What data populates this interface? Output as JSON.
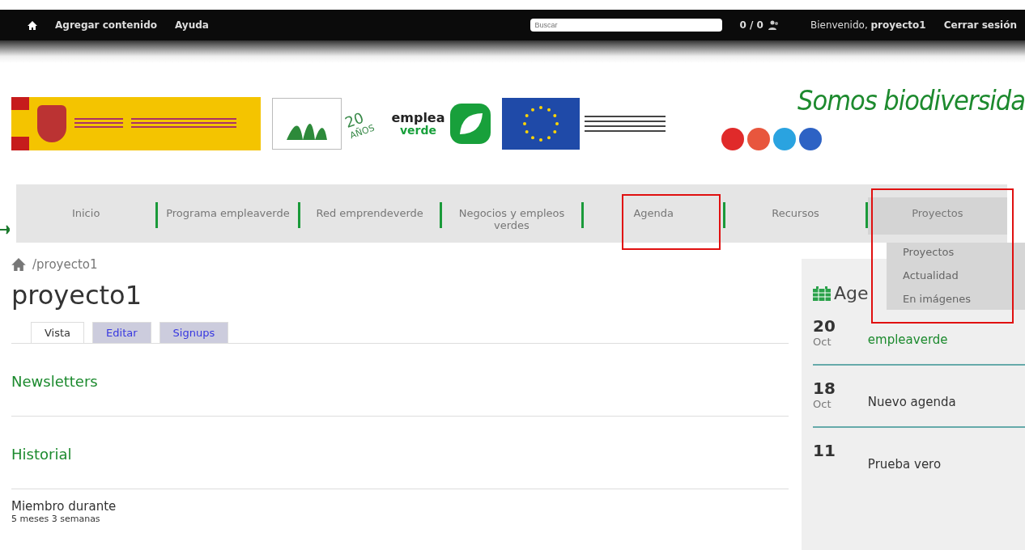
{
  "toolbar": {
    "items": [
      "Agregar contenido",
      "Ayuda"
    ],
    "search": {
      "placeholder": "Buscar"
    },
    "counter": "0 / 0",
    "welcome": "Bienvenido, **proyecto1**",
    "logout": "Cerrar sesión"
  },
  "header": {
    "anniversary": [
      "20",
      "AÑOS"
    ],
    "program": [
      "emplea",
      "verde"
    ],
    "slogan": "Somos biodiversida"
  },
  "nav": {
    "items": [
      {
        "label": "Inicio",
        "selected": false
      },
      {
        "label": "Programa empleaverde",
        "selected": false
      },
      {
        "label": "Red emprendeverde",
        "selected": false
      },
      {
        "label": "Negocios y empleos verdes",
        "selected": false
      },
      {
        "label": "Agenda",
        "selected": false
      },
      {
        "label": "Recursos",
        "selected": false
      },
      {
        "label": "Proyectos",
        "selected": true
      }
    ],
    "dropdown": [
      "Proyectos",
      "Actualidad",
      "En imágenes"
    ]
  },
  "breadcrumb": "/proyecto1",
  "title": "proyecto1",
  "tabs": [
    {
      "label": "Vista",
      "selected": true
    },
    {
      "label": "Editar",
      "selected": false
    },
    {
      "label": "Signups",
      "selected": false
    }
  ],
  "sections": [
    "Newsletters",
    "Historial"
  ],
  "member": {
    "label": "Miembro durante",
    "value": "5 meses 3 semanas"
  },
  "agenda": {
    "title": "Age",
    "events": [
      {
        "day": "20",
        "month": "Oct",
        "title": "empleaverde",
        "highlighted": true
      },
      {
        "day": "18",
        "month": "Oct",
        "title": "Nuevo agenda",
        "highlighted": false
      },
      {
        "day": "11",
        "title": "Prueba vero",
        "highlighted": false
      }
    ]
  }
}
